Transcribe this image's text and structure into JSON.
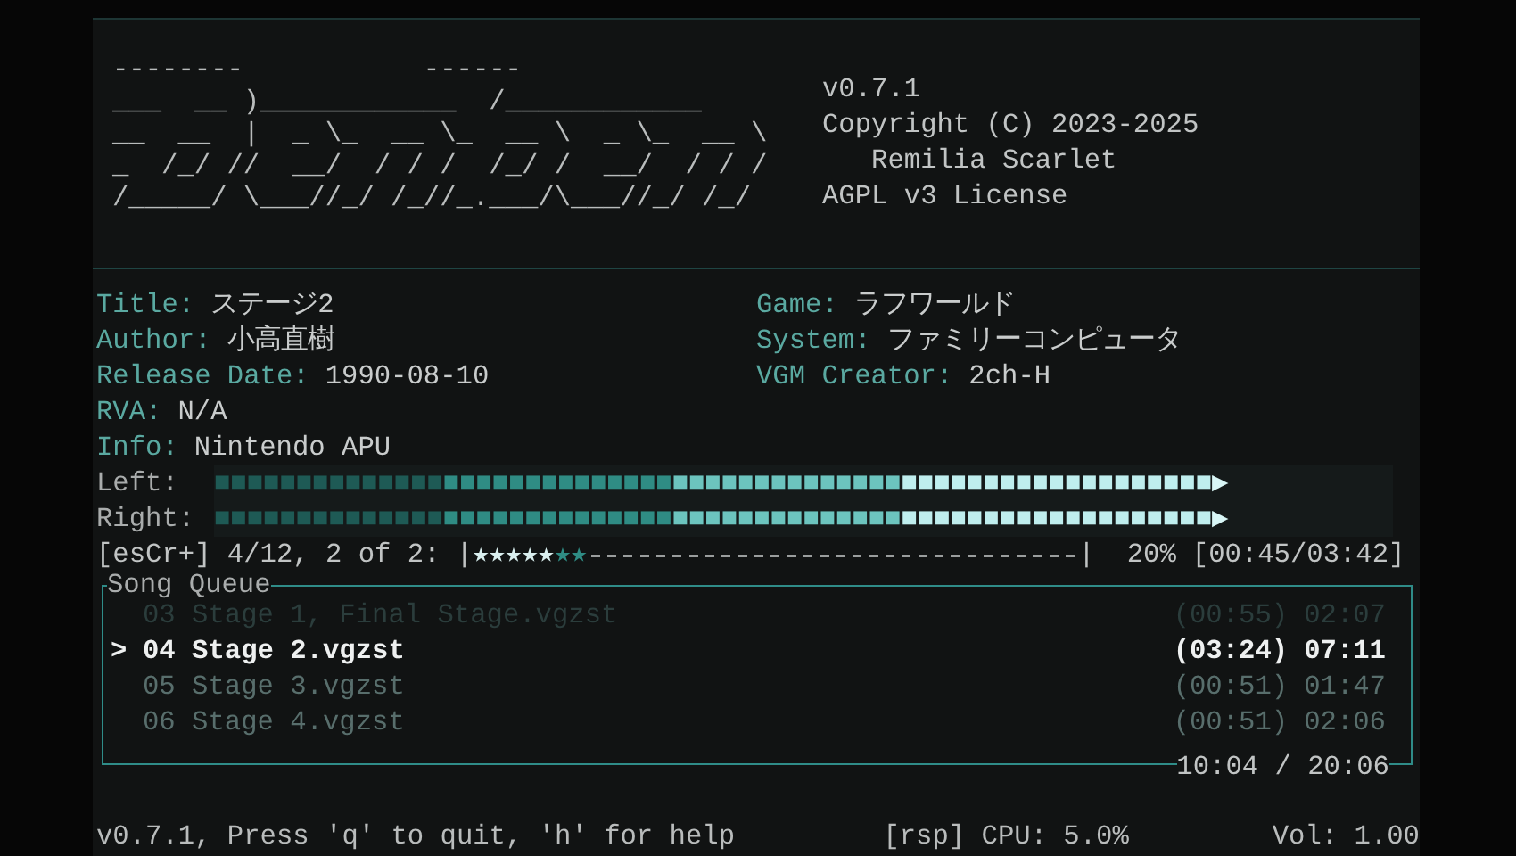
{
  "header": {
    "ascii_art": [
      "--------           ------",
      "___  __ )____________  /____________",
      "__  __  |  _ \\_  __ \\_  __ \\  _ \\_  __ \\",
      "_  /_/ //  __/  / / /  /_/ /  __/  / / /",
      "/_____/ \\___//_/ /_//_.___/\\___//_/ /_/"
    ],
    "info": [
      "v0.7.1",
      "Copyright (C) 2023-2025",
      "   Remilia Scarlet",
      "AGPL v3 License"
    ]
  },
  "metadata": {
    "left": [
      {
        "label": "Title:",
        "value": "ステージ2"
      },
      {
        "label": "Author:",
        "value": "小高直樹"
      },
      {
        "label": "Release Date:",
        "value": "1990-08-10"
      },
      {
        "label": "RVA:",
        "value": "N/A"
      },
      {
        "label": "Info:",
        "value": "Nintendo APU"
      }
    ],
    "right": [
      {
        "label": "Game:",
        "value": "ラフワールド"
      },
      {
        "label": "System:",
        "value": "ファミリーコンピュータ"
      },
      {
        "label": "VGM Creator:",
        "value": "2ch-H"
      }
    ]
  },
  "meter_glyphs": {
    "block": "■",
    "tip": "▶"
  },
  "meters": [
    {
      "label": "Left:",
      "level": 0.87
    },
    {
      "label": "Right:",
      "level": 0.87
    }
  ],
  "progress": {
    "prefix": "[esCr+] 4/12, 2 of 2:",
    "bar_start": "|",
    "bar_end": "|",
    "fill_char": "★",
    "level": 0.19,
    "percent": "20%",
    "time": "[00:45/03:42]"
  },
  "queue": {
    "title": "Song Queue",
    "cursor": ">",
    "total": "10:04 / 20:06",
    "items": [
      {
        "name": "03 Stage 1, Final Stage.vgzst",
        "elapsed": "(00:55)",
        "duration": "02:07",
        "played": true,
        "selected": false
      },
      {
        "name": "04 Stage 2.vgzst",
        "elapsed": "(03:24)",
        "duration": "07:11",
        "played": false,
        "selected": true
      },
      {
        "name": "05 Stage 3.vgzst",
        "elapsed": "(00:51)",
        "duration": "01:47",
        "played": false,
        "selected": false
      },
      {
        "name": "06 Stage 4.vgzst",
        "elapsed": "(00:51)",
        "duration": "02:06",
        "played": false,
        "selected": false
      }
    ]
  },
  "status_bar": {
    "help": "v0.7.1, Press 'q' to quit, 'h' for help",
    "cpu": "[rsp] CPU: 5.0%",
    "volume": "Vol: 1.00"
  }
}
